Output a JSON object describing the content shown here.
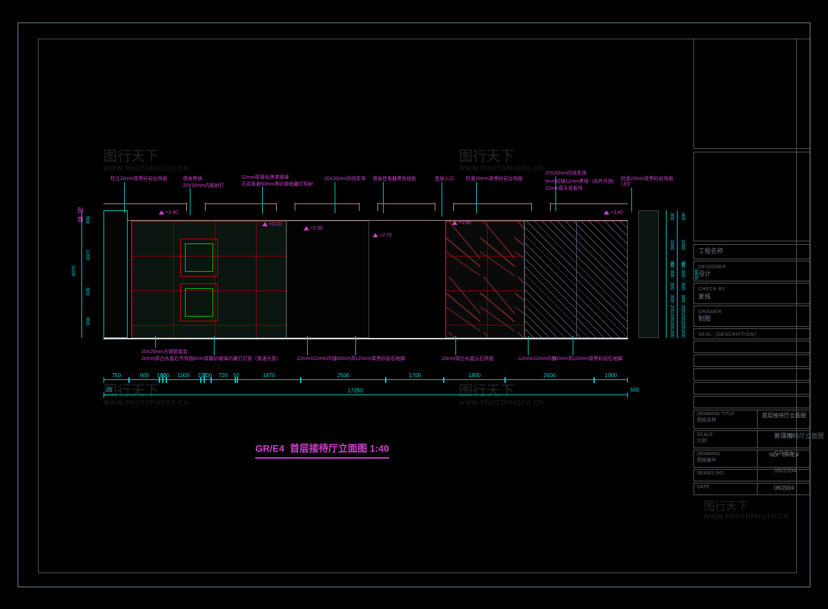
{
  "drawing": {
    "title_ref": "GR/E4",
    "title": "首层接待厅立面图 1:40",
    "sheet_title": "首层接待厅立面图",
    "scale": "1:40",
    "drawing_no": "GR/E4",
    "date": "08/2004"
  },
  "titleblock": {
    "project_label_en": "",
    "project_label_cn": "工程名称",
    "designer_en": "DESIGNER",
    "designer_cn": "设计",
    "check_en": "CHECK BY",
    "check_cn": "复核",
    "drawer_en": "DRAWER",
    "drawer_cn": "制图",
    "seal": "SEAL:  (DESCRIPTION)",
    "drawtitle_en": "DRAWING TITLE",
    "drawtitle_cn": "图纸名称",
    "scale_en": "SCALE",
    "scale_cn": "比例",
    "scale_prefix": "S:",
    "no_en": "DRAWING",
    "no_cn": "图纸编号",
    "no_prefix": "NO:",
    "series_en": "SERIES NO:",
    "date_en": "DATE:"
  },
  "annotations": {
    "a1": "柱立20mm厚黑砂岩台饰面",
    "a2": "墙身黑镜",
    "a2b": "20X20mm内嵌射灯",
    "a3": "12mm厚钢化烤漆玻璃",
    "a3b": "天花板嵌60mm黑砂钢暗藏灯照射",
    "a4": "20X20mm凹线条饰",
    "a5": "墙身挂电器黑色线板",
    "a6": "首层入口",
    "a7": "柱面20mm厚黑砂岩台饰面",
    "a8": "20X20mm凹线条饰",
    "a9": "6mm光镜12mm黑镜（向外开放）",
    "a9b": "12mm厚天花板饰",
    "a10": "柱面20mm厚黑砂岩饰面",
    "a10b": "LED",
    "b1": "20X20mm方钢管架金",
    "b1b": "20mm厚白水晶石节饰面",
    "b2": "8mm厚磨砂玻璃内藏灯灯管（普通光管）",
    "b3": "12mmX12mm凹线",
    "b4": "100mm高x20mm厚黑砂岩石地脚",
    "b5": "20mm厚白水晶云石饰面",
    "b6": "12mmx12mm凹线",
    "b7": "100mm高x20mm厚黑砂岩石地脚"
  },
  "elevations": {
    "e1": "+3.40",
    "e2": "+3.10",
    "e3": "+2.95",
    "e4": "+2.70",
    "e5": "+2.95",
    "e6": "+3.40"
  },
  "dims_bottom_1": [
    "750",
    "900",
    "100",
    "100",
    "1000",
    "100",
    "200",
    "720",
    "50",
    "1870",
    "2500",
    "1700",
    "1800",
    "2600",
    "1000"
  ],
  "dims_bottom_2_left": "20",
  "dims_bottom_total": "17280",
  "dims_bottom_2_right": "500",
  "dims_left": [
    "600",
    "1200",
    "800",
    "800"
  ],
  "dims_left_total": "3100",
  "dims_right_1": [
    "300",
    "1000",
    "50",
    "50",
    "300",
    "300",
    "300",
    "200",
    "200",
    "200",
    "200"
  ],
  "dims_right_total": "3400",
  "watermark": "图行天下",
  "watermark_sub": "WWW.PHOTOPHOTO.CN",
  "side": {
    "s1": "首层接待厅立面图",
    "s2": "GR/E4",
    "s3": "08/2004"
  }
}
